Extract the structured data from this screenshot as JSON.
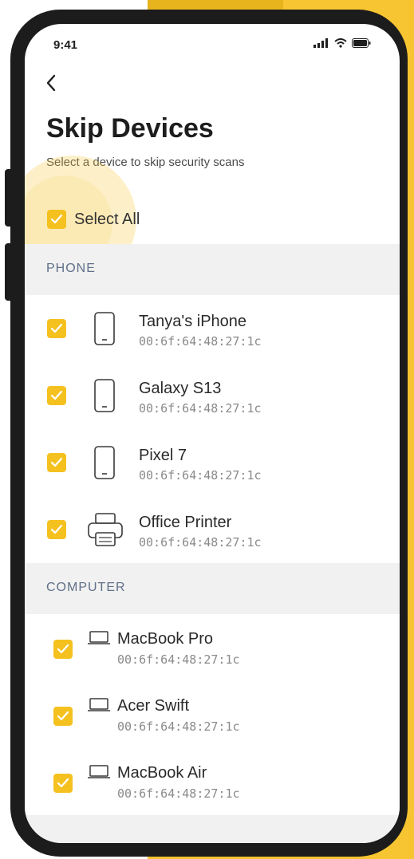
{
  "status": {
    "time": "9:41"
  },
  "header": {
    "title": "Skip Devices",
    "subtitle": "Select a device to skip security scans"
  },
  "select_all": {
    "label": "Select All",
    "checked": true
  },
  "sections": [
    {
      "title": "PHONE",
      "devices": [
        {
          "name": "Tanya's iPhone",
          "mac": "00:6f:64:48:27:1c",
          "icon": "phone-icon",
          "checked": true
        },
        {
          "name": "Galaxy S13",
          "mac": "00:6f:64:48:27:1c",
          "icon": "phone-icon",
          "checked": true
        },
        {
          "name": "Pixel 7",
          "mac": "00:6f:64:48:27:1c",
          "icon": "phone-icon",
          "checked": true
        },
        {
          "name": "Office Printer",
          "mac": "00:6f:64:48:27:1c",
          "icon": "printer-icon",
          "checked": true
        }
      ]
    },
    {
      "title": "COMPUTER",
      "devices": [
        {
          "name": "MacBook Pro",
          "mac": "00:6f:64:48:27:1c",
          "icon": "laptop-icon",
          "checked": true
        },
        {
          "name": "Acer Swift",
          "mac": "00:6f:64:48:27:1c",
          "icon": "laptop-icon",
          "checked": true
        },
        {
          "name": "MacBook Air",
          "mac": "00:6f:64:48:27:1c",
          "icon": "laptop-icon",
          "checked": true
        }
      ]
    }
  ],
  "colors": {
    "accent": "#F5C11F",
    "background_accent": "#F7C531",
    "frame": "#1c1c1c"
  }
}
